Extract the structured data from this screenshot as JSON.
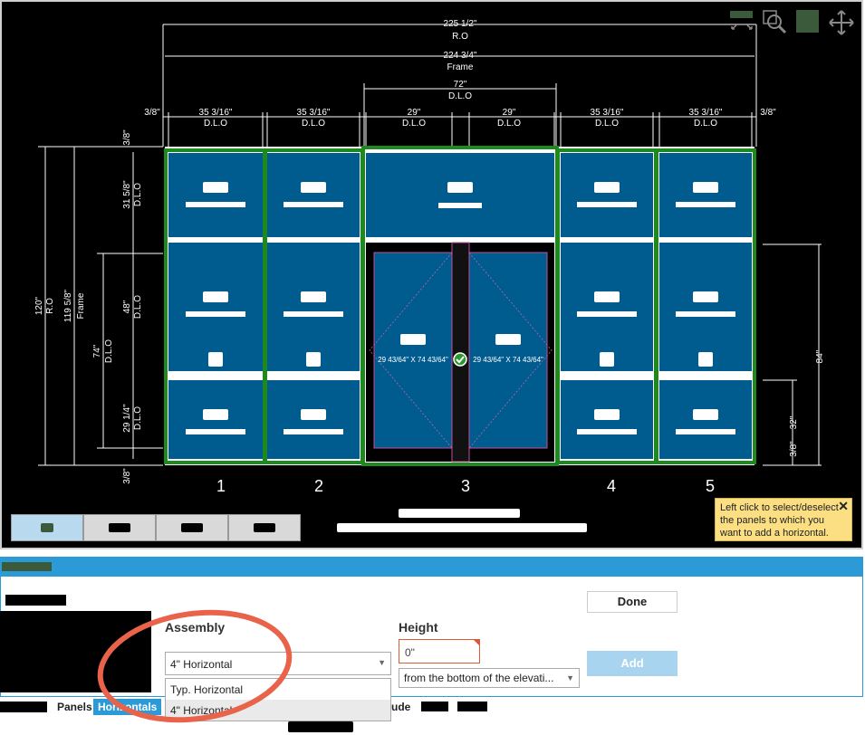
{
  "drawing": {
    "dim_ro_width": "225 1/2\"",
    "dim_ro_label": "R.O",
    "dim_frame_width": "224 3/4\"",
    "dim_frame_label": "Frame",
    "dim_center_dlo": "72\"",
    "dlo": "D.L.O",
    "dim_edge": "3/8\"",
    "col_width": "35 3/16\"",
    "door_width": "29\"",
    "dim_top_dlo": "31 5/8\"",
    "dim_mid_dlo": "48\"",
    "dim_bot_dlo": "29 1/4\"",
    "dim_ro_height": "120\"",
    "dim_frame_height": "119 5/8\"",
    "dim_door_dlo": "74\"",
    "dim_right_84": "84\"",
    "dim_right_32": "32\"",
    "door_label": "29 43/64\" X 74 43/64\"",
    "column_numbers": [
      "1",
      "2",
      "3",
      "4",
      "5"
    ]
  },
  "tooltip": {
    "text": "Left click to select/deselect the panels to which you want to add a horizontal.",
    "close": "✕"
  },
  "form": {
    "assembly_label": "Assembly",
    "assembly_value": "4\" Horizontal",
    "assembly_options": [
      "Typ. Horizontal",
      "4\" Horizontal"
    ],
    "height_label": "Height",
    "height_value": "0\"",
    "reference_value": "from the bottom of the elevati...",
    "done_label": "Done",
    "add_label": "Add"
  },
  "bottom_tabs": {
    "panels": "Panels",
    "horizontals": "Horizontals",
    "ude": "ude"
  },
  "colors": {
    "glass": "#005b8e",
    "frame_select": "#1e8a1e",
    "accent": "#2b9ad6",
    "highlight_ellipse": "#e8634a"
  },
  "icons": [
    "fit-view-icon",
    "zoom-icon",
    "color-swatch-icon",
    "pan-icon",
    "check-icon",
    "close-icon"
  ]
}
